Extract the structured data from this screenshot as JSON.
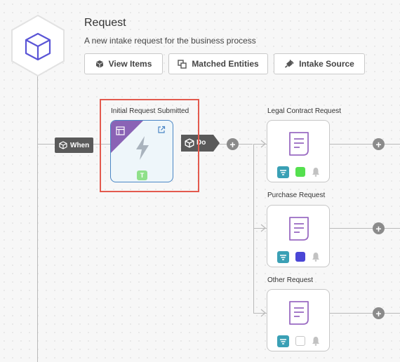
{
  "header": {
    "title": "Request",
    "subtitle": "A new intake request for the business process",
    "buttons": {
      "view_items": "View Items",
      "matched_entities": "Matched Entities",
      "intake_source": "Intake Source"
    }
  },
  "flow": {
    "when_label": "When",
    "do_label": "Do",
    "plus": "+",
    "trigger": {
      "label": "Initial Request Submitted",
      "badge": "T"
    },
    "requests": [
      {
        "label": "Legal Contract Request",
        "status_color": "#55e04f"
      },
      {
        "label": "Purchase Request",
        "status_color": "#4a46d6"
      },
      {
        "label": "Other Request",
        "status_color": "#ffffff"
      }
    ]
  },
  "colors": {
    "accent_purple": "#8a63b5",
    "hex_icon": "#5a55d6",
    "trigger_border": "#4a86c5",
    "highlight": "#e35a4e",
    "filter_badge": "#3aa0b5"
  }
}
